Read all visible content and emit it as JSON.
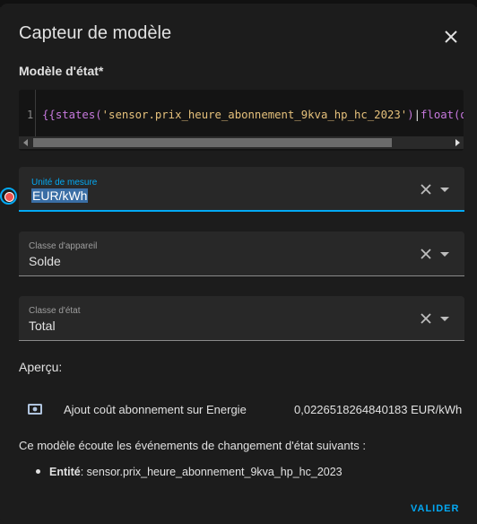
{
  "dialog": {
    "title": "Capteur de modèle",
    "close_icon": "close-icon"
  },
  "state_template": {
    "label": "Modèle d'état*",
    "line_number": "1",
    "code_prefix": "{{",
    "code_fn": "states(",
    "code_string": "'sensor.prix_heure_abonnement_9kva_hp_hc_2023'",
    "code_suffix": ")",
    "code_cursor": "|",
    "code_rest": "float(de"
  },
  "unit_field": {
    "label": "Unité de mesure",
    "value": "EUR/kWh"
  },
  "device_class_field": {
    "label": "Classe d'appareil",
    "value": "Solde"
  },
  "state_class_field": {
    "label": "Classe d'état",
    "value": "Total"
  },
  "preview": {
    "heading": "Aperçu:",
    "icon": "cash-icon",
    "entity_name": "Ajout coût abonnement sur Energie",
    "entity_value": "0,0226518264840183 EUR/kWh"
  },
  "listeners": {
    "heading": "Ce modèle écoute les événements de changement d'état suivants :",
    "entity_label": "Entité",
    "entity_id": ": sensor.prix_heure_abonnement_9kva_hp_hc_2023"
  },
  "actions": {
    "submit_label": "VALIDER"
  },
  "colors": {
    "accent": "#03a9f4",
    "background": "#1c1c1c",
    "field_bg": "#282828"
  }
}
